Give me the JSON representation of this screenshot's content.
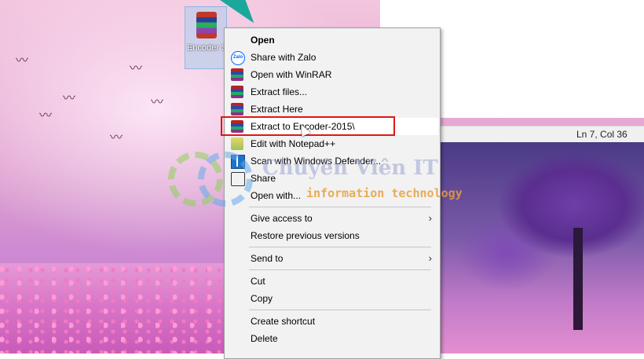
{
  "desktop": {
    "icon_label": "Encoder Share"
  },
  "notepad": {
    "status_position": "Ln 7, Col 36"
  },
  "watermark": {
    "title": "Chuyên Viên IT",
    "subtitle": "information technology"
  },
  "context_menu": {
    "items": [
      {
        "label": "Open",
        "icon": "none"
      },
      {
        "label": "Share with Zalo",
        "icon": "zalo-icon"
      },
      {
        "label": "Open with WinRAR",
        "icon": "winrar-icon"
      },
      {
        "label": "Extract files...",
        "icon": "winrar-icon"
      },
      {
        "label": "Extract Here",
        "icon": "winrar-icon"
      },
      {
        "label": "Extract to Encoder-2015\\",
        "icon": "winrar-icon"
      },
      {
        "label": "Edit with Notepad++",
        "icon": "notepad-plus-plus-icon"
      },
      {
        "label": "Scan with Windows Defender...",
        "icon": "windows-defender-icon"
      },
      {
        "label": "Share",
        "icon": "share-icon"
      },
      {
        "label": "Open with...",
        "icon": "none"
      },
      {
        "label": "Give access to",
        "icon": "none"
      },
      {
        "label": "Restore previous versions",
        "icon": "none"
      },
      {
        "label": "Send to",
        "icon": "none"
      },
      {
        "label": "Cut",
        "icon": "none"
      },
      {
        "label": "Copy",
        "icon": "none"
      },
      {
        "label": "Create shortcut",
        "icon": "none"
      },
      {
        "label": "Delete",
        "icon": "none"
      }
    ]
  },
  "colors": {
    "highlight_border": "#e01616",
    "menu_background": "#f2f2f2",
    "arrow_teal": "#1aa89a"
  }
}
